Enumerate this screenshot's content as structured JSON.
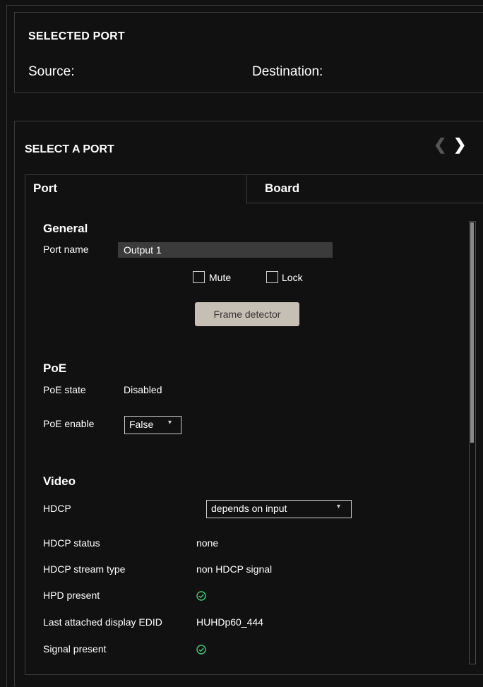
{
  "selected_port": {
    "title": "SELECTED PORT",
    "source_label": "Source:",
    "destination_label": "Destination:"
  },
  "select_port": {
    "title": "SELECT A PORT",
    "prev_icon": "chevron-left-icon",
    "next_icon": "chevron-right-icon"
  },
  "tabs": [
    {
      "label": "Port",
      "active": true
    },
    {
      "label": "Board",
      "active": false
    }
  ],
  "general": {
    "heading": "General",
    "port_name_label": "Port name",
    "port_name_value": "Output 1",
    "mute_label": "Mute",
    "mute_checked": false,
    "lock_label": "Lock",
    "lock_checked": false,
    "frame_detector_label": "Frame detector"
  },
  "poe": {
    "heading": "PoE",
    "state_label": "PoE state",
    "state_value": "Disabled",
    "enable_label": "PoE enable",
    "enable_value": "False"
  },
  "video": {
    "heading": "Video",
    "hdcp_label": "HDCP",
    "hdcp_value": "depends on input",
    "hdcp_status_label": "HDCP status",
    "hdcp_status_value": "none",
    "hdcp_stream_label": "HDCP stream type",
    "hdcp_stream_value": "non HDCP signal",
    "hpd_label": "HPD present",
    "hpd_icon": "check-circle-icon",
    "edid_label": "Last attached display EDID",
    "edid_value": "HUHDp60_444",
    "signal_label": "Signal present",
    "signal_icon": "check-circle-icon"
  },
  "colors": {
    "background": "#111111",
    "border": "#3a3a3a",
    "button_bg": "#c6bfb4",
    "status_ok": "#3ecf6e",
    "input_bg": "#3b3b3b"
  }
}
